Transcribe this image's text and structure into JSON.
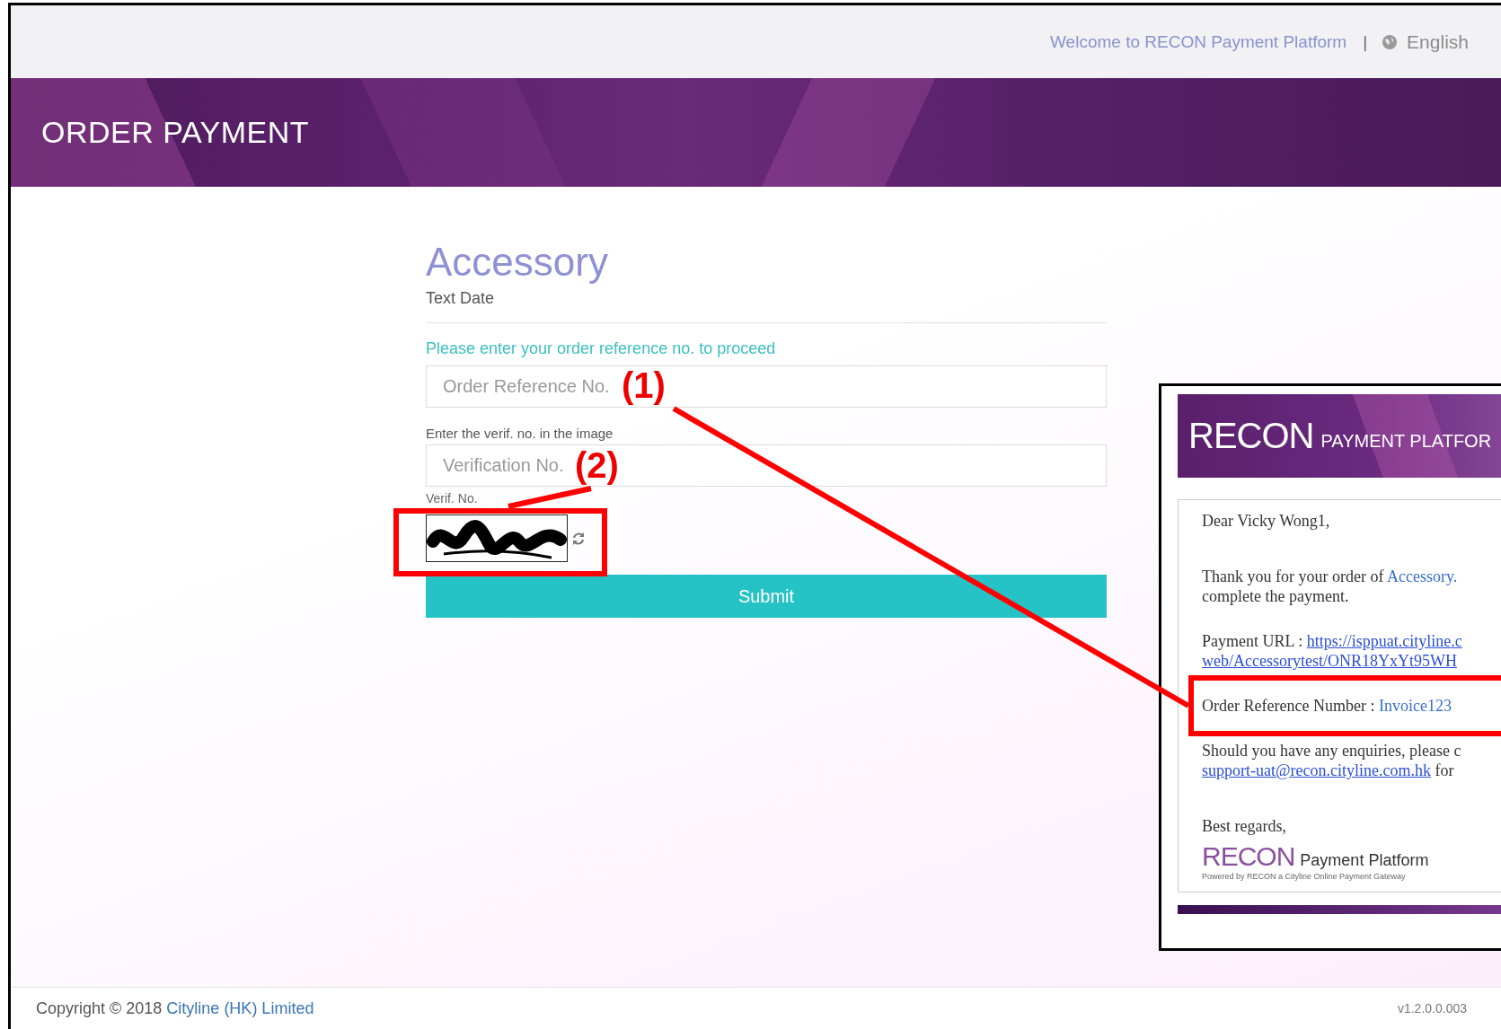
{
  "top_bar": {
    "welcome": "Welcome to RECON Payment Platform",
    "separator": "|",
    "language": "English"
  },
  "banner": {
    "title": "ORDER PAYMENT"
  },
  "form": {
    "title": "Accessory",
    "subtitle": "Text Date",
    "prompt": "Please enter your order reference no. to proceed",
    "order_field": {
      "placeholder": "Order Reference No."
    },
    "verif_label": "Enter the verif. no. in the image",
    "verif_field": {
      "placeholder": "Verification No."
    },
    "captcha_label": "Verif. No.",
    "submit": "Submit"
  },
  "annotations": [
    {
      "label": "(1)"
    },
    {
      "label": "(2)"
    }
  ],
  "email_inset": {
    "logo": "RECON",
    "logo_tagline": "PAYMENT PLATFOR",
    "greeting": "Dear Vicky Wong1,",
    "thanks_lead": "Thank you for your order of ",
    "thanks_item": "Accessory.",
    "thanks_line2": "complete the payment.",
    "url_label": "Payment URL : ",
    "url_line1": "https://isppuat.cityline.c",
    "url_line2": "web/Accessorytest/ONR18YxYt95WH",
    "ref_label": "Order Reference Number : ",
    "ref_value": "Invoice123",
    "enquiry_line": "Should you have any enquiries, please c",
    "support_email": "support-uat@recon.cityline.com.hk",
    "support_tail": " for",
    "closing": "Best regards,",
    "sign_logo": "RECON",
    "sign_name": "Payment Platform",
    "sign_powered": "Powered by RECON a Cityline Online Payment Gateway"
  },
  "footer": {
    "copyright": "Copyright © 2018 ",
    "company": "Cityline (HK) Limited",
    "version": "v1.2.0.0.003"
  }
}
